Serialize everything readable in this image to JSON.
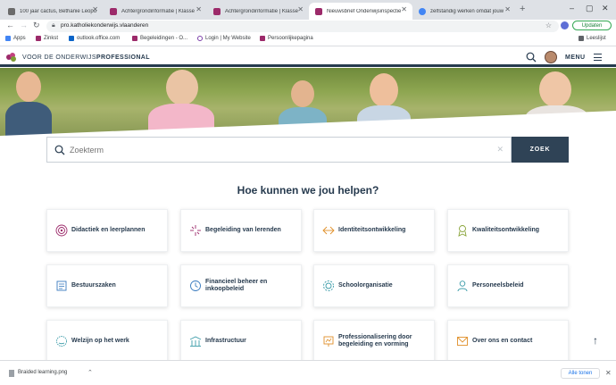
{
  "browser": {
    "tabs": [
      {
        "label": "100 jaar cactus, Bethanie Leopo",
        "color": "#6b6b6b"
      },
      {
        "label": "Achtergrondinformatie | Klasse",
        "color": "#9c2a6a"
      },
      {
        "label": "Achtergrondinformatie | Klasse",
        "color": "#9c2a6a"
      },
      {
        "label": "Nieuwsbrief Onderwijsinspectie",
        "color": "#9c2a6a"
      },
      {
        "label": "zelfstandig werken omdat jouw",
        "color": "#4285f4"
      }
    ],
    "new_tab": "+",
    "url": "pro.katholiekonderwijs.vlaanderen",
    "update_label": "Updaten",
    "bookmarks": [
      {
        "label": "Apps",
        "color": "#4285f4"
      },
      {
        "label": "Zinkst",
        "color": "#9c2a6a"
      },
      {
        "label": "outlook.office.com",
        "color": "#0a64c8"
      },
      {
        "label": "Begeleidingen - O...",
        "color": "#9c2a6a"
      },
      {
        "label": "Login | My Website",
        "color": "#7a3ea8"
      },
      {
        "label": "Persoonlijkepagina",
        "color": "#9c2a6a"
      }
    ],
    "reading_list": "Leeslijst"
  },
  "site": {
    "logo_prefix": "VOOR DE ONDERWIJS",
    "logo_suffix": "PROFESSIONAL",
    "menu_label": "MENU"
  },
  "search": {
    "placeholder": "Zoekterm",
    "clear_glyph": "✕",
    "button_label": "ZOEK"
  },
  "help": {
    "title": "Hoe kunnen we jou helpen?",
    "cards": [
      {
        "label": "Didactiek en leerplannen",
        "icon": "target-icon",
        "color": "#9c2a6a"
      },
      {
        "label": "Begeleiding van lerenden",
        "icon": "spark-icon",
        "color": "#9c2a6a"
      },
      {
        "label": "Identiteitsontwikkeling",
        "icon": "arrows-icon",
        "color": "#e0902a"
      },
      {
        "label": "Kwaliteitsontwikkeling",
        "icon": "medal-icon",
        "color": "#8aa43a"
      },
      {
        "label": "Bestuurszaken",
        "icon": "document-icon",
        "color": "#3a7bbf"
      },
      {
        "label": "Financieel beheer en inkoopbeleid",
        "icon": "clock-icon",
        "color": "#3a7bbf"
      },
      {
        "label": "Schoolorganisatie",
        "icon": "gear-icon",
        "color": "#3a9ba8"
      },
      {
        "label": "Personeelsbeleid",
        "icon": "person-icon",
        "color": "#3a9ba8"
      },
      {
        "label": "Welzijn op het werk",
        "icon": "globe-icon",
        "color": "#3a9ba8"
      },
      {
        "label": "Infrastructuur",
        "icon": "building-icon",
        "color": "#3a9ba8"
      },
      {
        "label": "Professionalisering door begeleiding en vorming",
        "icon": "presentation-icon",
        "color": "#e0902a"
      },
      {
        "label": "Over ons en contact",
        "icon": "contact-icon",
        "color": "#e0902a"
      }
    ]
  },
  "downloads": {
    "file_name": "Braided learning.png",
    "show_all_label": "Alle tonen"
  }
}
